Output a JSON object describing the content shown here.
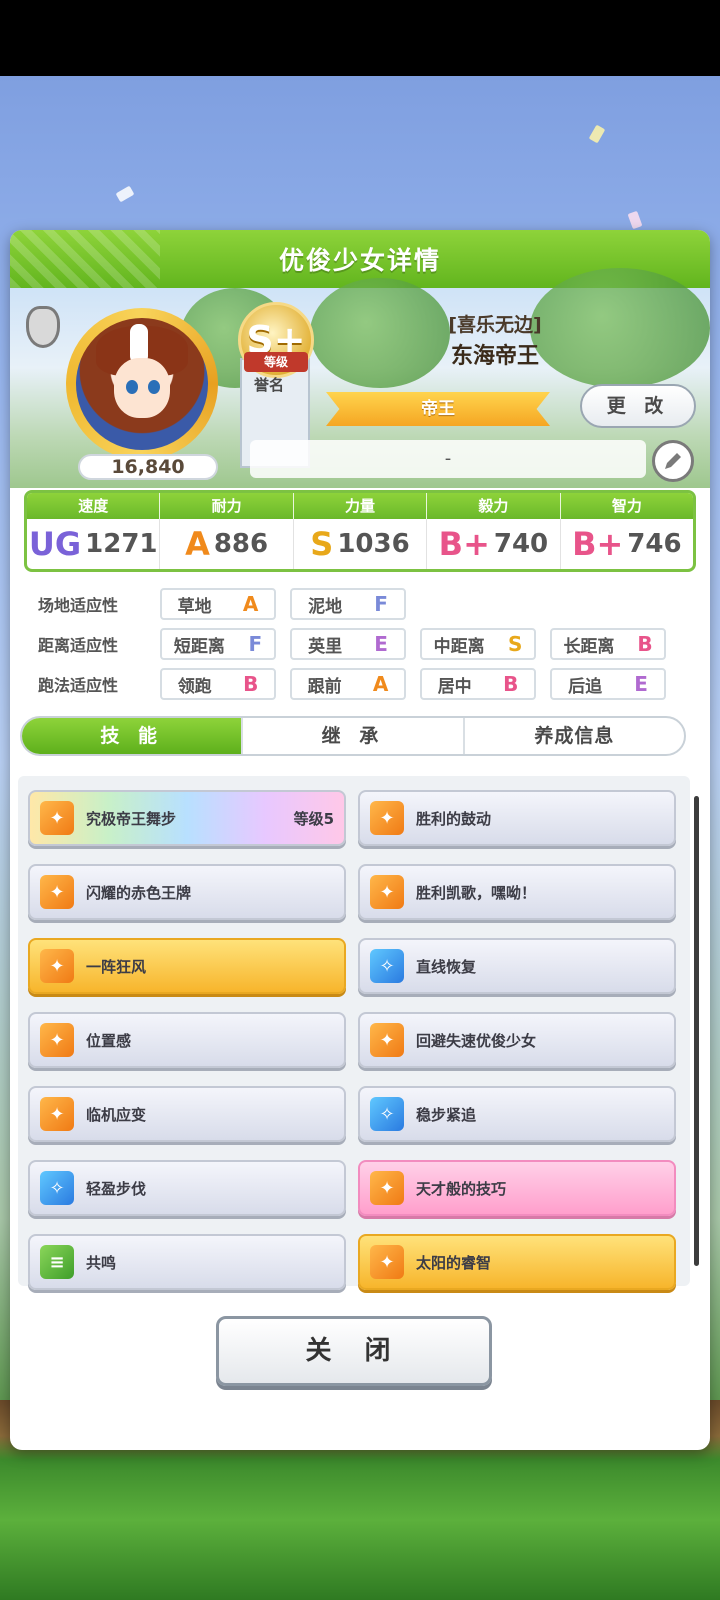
{
  "panel": {
    "title": "优俊少女详情"
  },
  "profile": {
    "fans": "16,840",
    "rank": {
      "badge": "S+",
      "ribbon": "等级"
    },
    "honor_label": "誉名",
    "title_bracket": "[喜乐无边]",
    "name": "东海帝王",
    "epithet": "帝王",
    "change_label": "更 改",
    "memo": "-"
  },
  "stats": {
    "headers": [
      "速度",
      "耐力",
      "力量",
      "毅力",
      "智力"
    ],
    "items": [
      {
        "grade": "UG",
        "value": "1271",
        "color": "#7a62d8"
      },
      {
        "grade": "A",
        "value": "886",
        "color": "#f08a1c"
      },
      {
        "grade": "S",
        "value": "1036",
        "color": "#e8a81a"
      },
      {
        "grade": "B+",
        "value": "740",
        "color": "#e8548a"
      },
      {
        "grade": "B+",
        "value": "746",
        "color": "#e8548a"
      }
    ]
  },
  "aptitudes": [
    {
      "label": "场地适应性",
      "items": [
        {
          "name": "草地",
          "grade": "A",
          "color": "#f08a1c"
        },
        {
          "name": "泥地",
          "grade": "F",
          "color": "#7a8ad8"
        }
      ]
    },
    {
      "label": "距离适应性",
      "items": [
        {
          "name": "短距离",
          "grade": "F",
          "color": "#7a8ad8"
        },
        {
          "name": "英里",
          "grade": "E",
          "color": "#b06ad0"
        },
        {
          "name": "中距离",
          "grade": "S",
          "color": "#e8a81a"
        },
        {
          "name": "长距离",
          "grade": "B",
          "color": "#e8548a"
        }
      ]
    },
    {
      "label": "跑法适应性",
      "items": [
        {
          "name": "领跑",
          "grade": "B",
          "color": "#e8548a"
        },
        {
          "name": "跟前",
          "grade": "A",
          "color": "#f08a1c"
        },
        {
          "name": "居中",
          "grade": "B",
          "color": "#e8548a"
        },
        {
          "name": "后追",
          "grade": "E",
          "color": "#b06ad0"
        }
      ]
    }
  ],
  "tabs": [
    "技 能",
    "继 承",
    "养成信息"
  ],
  "skills": [
    {
      "name": "究极帝王舞步",
      "level": "等级5",
      "style": "rainbow",
      "icon": "orange"
    },
    {
      "name": "胜利的鼓动",
      "level": "",
      "style": "",
      "icon": "orange"
    },
    {
      "name": "闪耀的赤色王牌",
      "level": "",
      "style": "",
      "icon": "orange"
    },
    {
      "name": "胜利凯歌，嘿呦！",
      "level": "",
      "style": "",
      "icon": "orange"
    },
    {
      "name": "一阵狂风",
      "level": "",
      "style": "gold",
      "icon": "orange"
    },
    {
      "name": "直线恢复",
      "level": "",
      "style": "",
      "icon": "blue"
    },
    {
      "name": "位置感",
      "level": "",
      "style": "",
      "icon": "orange"
    },
    {
      "name": "回避失速优俊少女",
      "level": "",
      "style": "",
      "icon": "orange"
    },
    {
      "name": "临机应变",
      "level": "",
      "style": "",
      "icon": "orange"
    },
    {
      "name": "稳步紧追",
      "level": "",
      "style": "",
      "icon": "blue"
    },
    {
      "name": "轻盈步伐",
      "level": "",
      "style": "",
      "icon": "blue"
    },
    {
      "name": "天才般的技巧",
      "level": "",
      "style": "pink",
      "icon": "orange"
    },
    {
      "name": "共鸣",
      "level": "",
      "style": "",
      "icon": "green"
    },
    {
      "name": "太阳的睿智",
      "level": "",
      "style": "gold",
      "icon": "orange"
    }
  ],
  "close_label": "关 闭"
}
